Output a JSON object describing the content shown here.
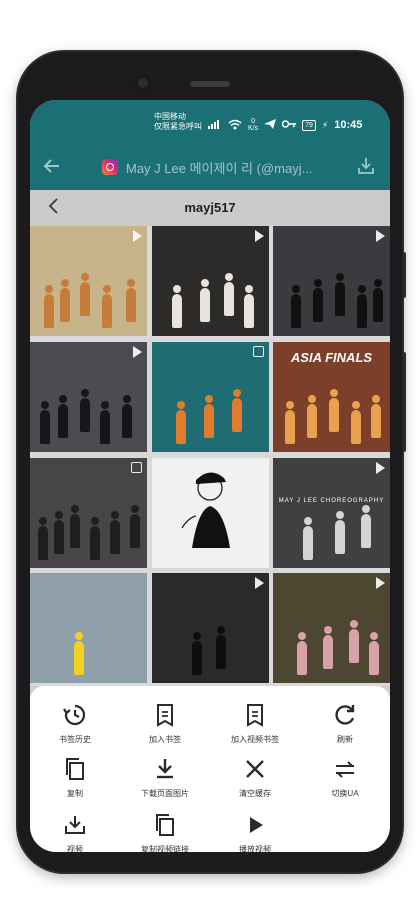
{
  "status_bar": {
    "carrier_line1": "中国移动",
    "carrier_line2": "仅限紧急呼叫",
    "speed_value": "0",
    "speed_unit": "K/s",
    "battery": "79",
    "time": "10:45"
  },
  "app_bar": {
    "title": "May J Lee 메이제이 리 (@mayj..."
  },
  "web_header": {
    "username": "mayj517"
  },
  "grid": {
    "tiles": [
      {
        "bg": "#c8b48a",
        "badge": "play",
        "figs": "#c77d3a"
      },
      {
        "bg": "#2d2b2a",
        "badge": "play",
        "figs": "#e8e4dd"
      },
      {
        "bg": "#3a3b3e",
        "badge": "play",
        "figs": "#101010"
      },
      {
        "bg": "#4a4c52",
        "badge": "play",
        "figs": "#15151a"
      },
      {
        "bg": "#1f6d73",
        "badge": "multi",
        "figs": "#e27b2b"
      },
      {
        "bg": "#7b3f2a",
        "badge": "none",
        "figs": "#e9a14f"
      },
      {
        "bg": "#464648",
        "badge": "multi",
        "figs": "#1e1e1e"
      },
      {
        "bg": "#f1f1f1",
        "badge": "none",
        "figs": "#111111"
      },
      {
        "bg": "#3f4042",
        "badge": "play",
        "figs": "#d4d4d4"
      },
      {
        "bg": "#8fa0aa",
        "badge": "none",
        "figs": "#f2d020"
      },
      {
        "bg": "#2a2a2b",
        "badge": "play",
        "figs": "#0d0d0d"
      },
      {
        "bg": "#4d4630",
        "badge": "play",
        "figs": "#d9a1a9"
      }
    ],
    "tile7_tag": "ASIA FINALS",
    "tile9_tag": "MAY J LEE CHOREOGRAPHY"
  },
  "sheet": {
    "actions": [
      {
        "label": "书签历史",
        "icon": "history-icon"
      },
      {
        "label": "加入书签",
        "icon": "bookmark-icon"
      },
      {
        "label": "加入视频书签",
        "icon": "video-bookmark-icon"
      },
      {
        "label": "刷新",
        "icon": "refresh-icon"
      },
      {
        "label": "复制",
        "icon": "copy-icon"
      },
      {
        "label": "下载页面图片",
        "icon": "download-images-icon"
      },
      {
        "label": "清空缓存",
        "icon": "clear-cache-icon"
      },
      {
        "label": "切换UA",
        "icon": "switch-ua-icon"
      },
      {
        "label": "视频",
        "icon": "video-download-icon"
      },
      {
        "label": "复制视频链接",
        "icon": "copy-video-link-icon"
      },
      {
        "label": "播放视频",
        "icon": "play-video-icon"
      }
    ]
  },
  "colors": {
    "app_bar": "#1a7074",
    "sheet": "#ffffff",
    "icon": "#2b2b2b"
  }
}
